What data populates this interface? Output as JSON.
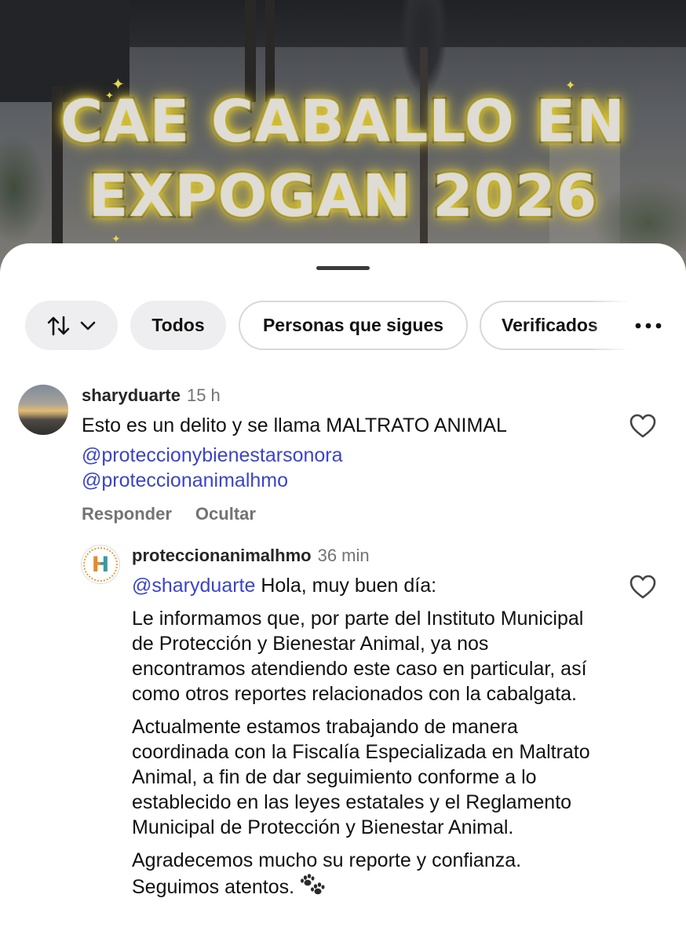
{
  "video": {
    "headline_line1": "CAE CABALLO EN",
    "headline_line2": "EXPOGAN 2026"
  },
  "filters": {
    "sort_icon": "sort-arrows-icon",
    "chips": [
      "Todos",
      "Personas que sigues",
      "Verificados"
    ],
    "more_icon": "more-horizontal-icon"
  },
  "comments": [
    {
      "username": "sharyduarte",
      "time": "15 h",
      "text": "Esto es un delito y se llama MALTRATO ANIMAL",
      "mentions": [
        "@proteccionybienestarsonora",
        "@proteccionanimalhmo"
      ],
      "reply_label": "Responder",
      "hide_label": "Ocultar",
      "like_icon": "heart-icon"
    }
  ],
  "reply": {
    "username": "proteccionanimalhmo",
    "time": "36 min",
    "avatar_letter": "H",
    "mention": "@sharyduarte",
    "greeting": " Hola, muy buen día:",
    "paragraph1": "Le informamos que, por parte del Instituto Municipal de Protección y Bienestar Animal, ya nos encontramos atendiendo este caso en particular, así como otros reportes relacionados con la cabalgata.",
    "paragraph2": "Actualmente estamos trabajando de manera coordinada con la Fiscalía Especializada en Maltrato Animal, a fin de dar seguimiento conforme a lo establecido en las leyes estatales y el Reglamento Municipal de Protección y Bienestar Animal.",
    "paragraph3": "Agradecemos mucho su reporte y confianza. Seguimos atentos.",
    "emoji_icon": "paw-prints-icon",
    "like_icon": "heart-icon"
  },
  "colors": {
    "mention": "#3b44c8",
    "meta_gray": "#737373",
    "chip_fill": "#eeeef0",
    "headline_glow": "#e6d03a"
  }
}
